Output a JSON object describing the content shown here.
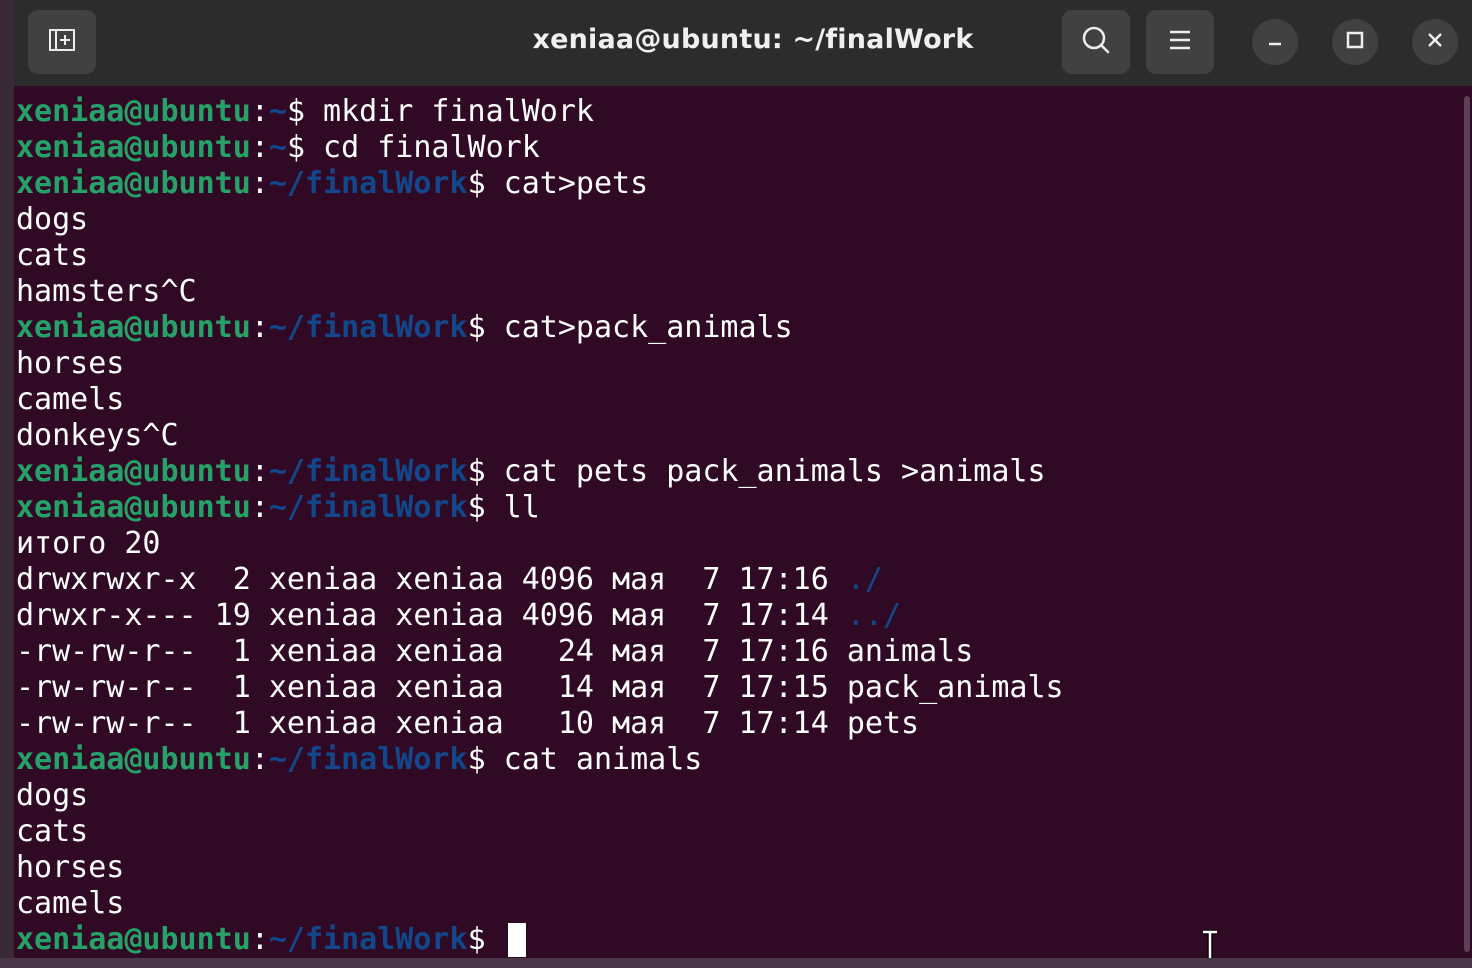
{
  "window": {
    "title": "xeniaa@ubuntu: ~/finalWork"
  },
  "titlebar": {
    "new_tab_icon": "new-tab-icon",
    "search_icon": "search-icon",
    "menu_icon": "hamburger-menu-icon",
    "minimize_icon": "minimize-icon",
    "maximize_icon": "maximize-icon",
    "close_icon": "close-icon"
  },
  "terminal": {
    "prompt_user": "xeniaa@ubuntu",
    "lines": [
      {
        "type": "prompt",
        "path": "~",
        "cmd": " mkdir finalWork"
      },
      {
        "type": "prompt",
        "path": "~",
        "cmd": " cd finalWork"
      },
      {
        "type": "prompt",
        "path": "~/finalWork",
        "cmd": " cat>pets"
      },
      {
        "type": "out",
        "text": "dogs"
      },
      {
        "type": "out",
        "text": "cats"
      },
      {
        "type": "out",
        "text": "hamsters^C"
      },
      {
        "type": "prompt",
        "path": "~/finalWork",
        "cmd": " cat>pack_animals"
      },
      {
        "type": "out",
        "text": "horses"
      },
      {
        "type": "out",
        "text": "camels"
      },
      {
        "type": "out",
        "text": "donkeys^C"
      },
      {
        "type": "prompt",
        "path": "~/finalWork",
        "cmd": " cat pets pack_animals >animals"
      },
      {
        "type": "prompt",
        "path": "~/finalWork",
        "cmd": " ll"
      },
      {
        "type": "out",
        "text": "итого 20"
      },
      {
        "type": "ls",
        "text": "drwxrwxr-x  2 xeniaa xeniaa 4096 мая  7 17:16 ",
        "name": "./",
        "dir": true
      },
      {
        "type": "ls",
        "text": "drwxr-x--- 19 xeniaa xeniaa 4096 мая  7 17:14 ",
        "name": "../",
        "dir": true
      },
      {
        "type": "ls",
        "text": "-rw-rw-r--  1 xeniaa xeniaa   24 мая  7 17:16 ",
        "name": "animals",
        "dir": false
      },
      {
        "type": "ls",
        "text": "-rw-rw-r--  1 xeniaa xeniaa   14 мая  7 17:15 ",
        "name": "pack_animals",
        "dir": false
      },
      {
        "type": "ls",
        "text": "-rw-rw-r--  1 xeniaa xeniaa   10 мая  7 17:14 ",
        "name": "pets",
        "dir": false
      },
      {
        "type": "prompt",
        "path": "~/finalWork",
        "cmd": " cat animals"
      },
      {
        "type": "out",
        "text": "dogs"
      },
      {
        "type": "out",
        "text": "cats"
      },
      {
        "type": "out",
        "text": "horses"
      },
      {
        "type": "out",
        "text": "camels"
      },
      {
        "type": "prompt",
        "path": "~/finalWork",
        "cmd": " ",
        "cursor": true
      }
    ]
  },
  "colors": {
    "background": "#300a24",
    "user": "#26a269",
    "path": "#12488b",
    "text": "#ffffff",
    "titlebar": "#2c2c2c"
  }
}
